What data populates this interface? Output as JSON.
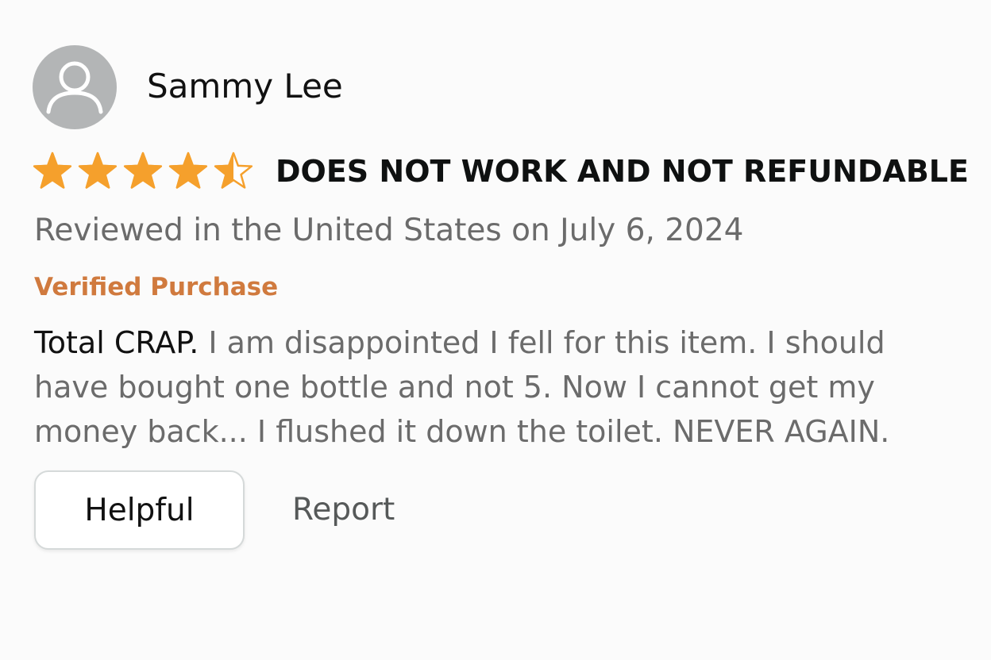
{
  "reviewer": {
    "name": "Sammy Lee",
    "avatar_icon": "user-silhouette-icon"
  },
  "review": {
    "rating": 4.5,
    "rating_max": 5,
    "star_color": "#f5a02c",
    "title": "DOES NOT WORK AND NOT REFUNDABLE",
    "meta": "Reviewed in the United States on July 6, 2024",
    "verified_label": "Verified Purchase",
    "verified_color": "#d07a3e",
    "body_lead": "Total CRAP.",
    "body_rest": " I am disappointed I fell for this item. I should have bought one bottle and not 5. Now I cannot get my money back... I flushed it down the toilet. NEVER AGAIN."
  },
  "actions": {
    "helpful_label": "Helpful",
    "report_label": "Report"
  }
}
